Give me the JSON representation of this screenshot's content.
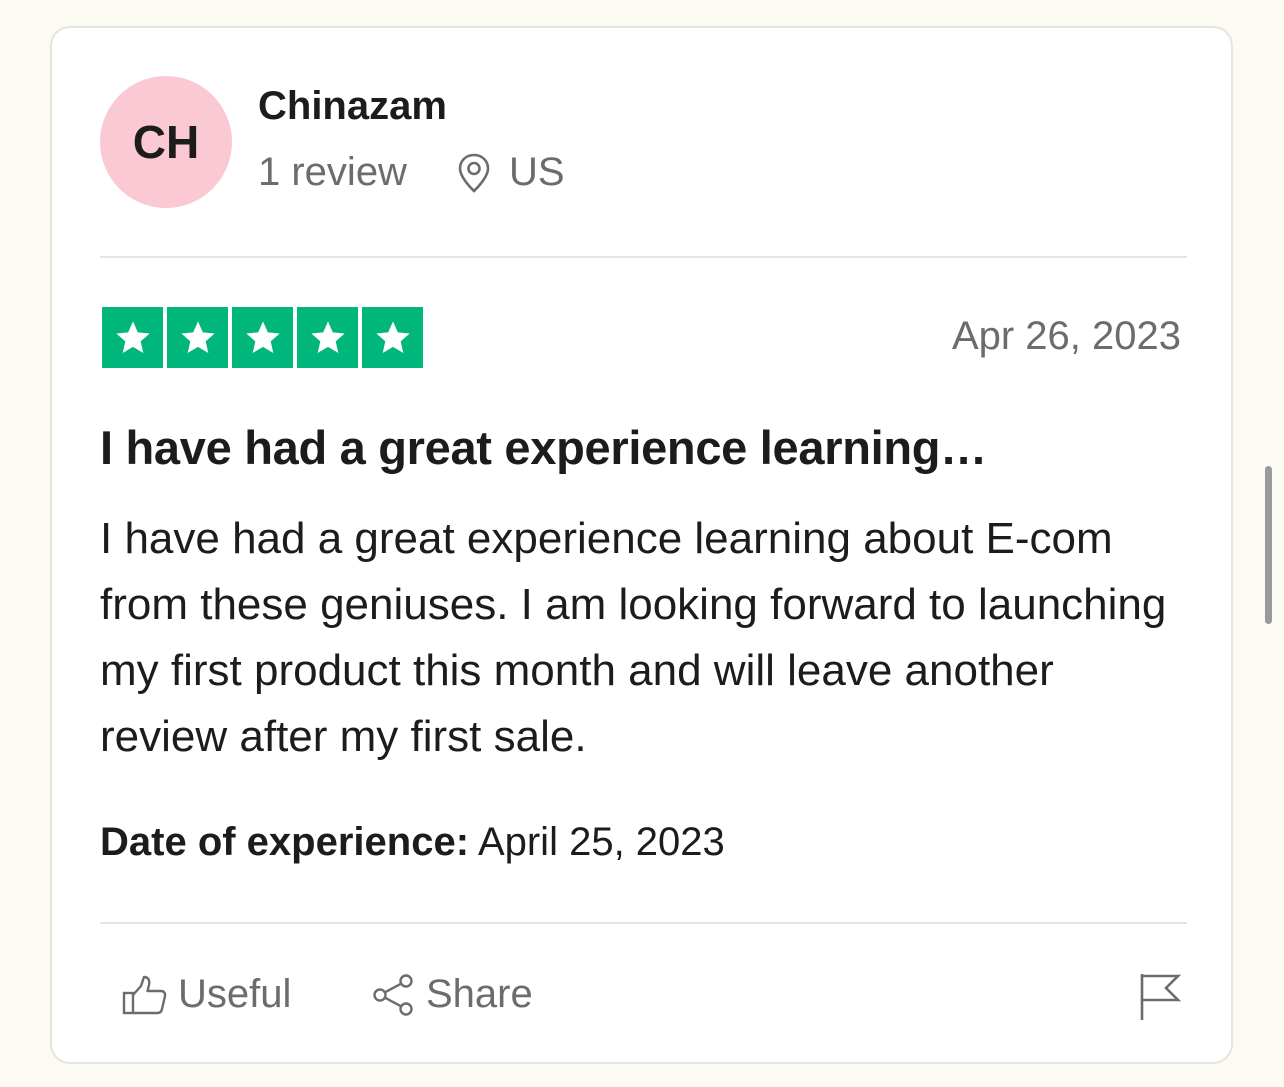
{
  "reviewer": {
    "initials": "CH",
    "name": "Chinazam",
    "review_count": "1 review",
    "country": "US"
  },
  "rating": {
    "stars": 5,
    "max_stars": 5,
    "star_color": "#00b67a"
  },
  "review": {
    "date": "Apr 26, 2023",
    "title": "I have had a great experience learning…",
    "body": "I have had a great experience learning about E-com from these geniuses. I am looking forward to launching my first product this month and will leave another review after my first sale.",
    "experience_label": "Date of experience:",
    "experience_date": "April 25, 2023"
  },
  "actions": {
    "useful_label": "Useful",
    "share_label": "Share"
  },
  "colors": {
    "avatar_bg": "#fbc9d3",
    "muted_text": "#6c6c6c",
    "page_bg": "#fbfaf3"
  }
}
